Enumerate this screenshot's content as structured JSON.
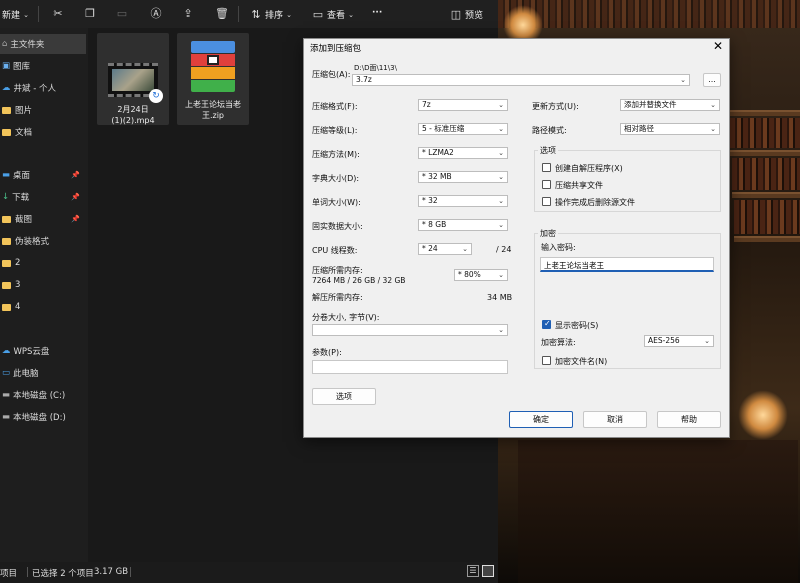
{
  "toolbar": {
    "new_label": "新建",
    "sort_label": "排序",
    "view_label": "查看",
    "more_label": "···",
    "preview_label": "预览"
  },
  "sidebar": {
    "items": [
      {
        "label": "主文件夹",
        "icon": "home-icon"
      },
      {
        "label": "图库",
        "icon": "gallery-icon"
      },
      {
        "label": "井斌 - 个人",
        "icon": "cloud-icon"
      },
      {
        "label": "图片",
        "icon": "folder-icon"
      },
      {
        "label": "文档",
        "icon": "folder-icon"
      },
      {
        "label": "桌面",
        "icon": "desktop-icon"
      },
      {
        "label": "下载",
        "icon": "download-icon"
      },
      {
        "label": "截图",
        "icon": "folder-icon"
      },
      {
        "label": "伪装格式",
        "icon": "folder-icon"
      },
      {
        "label": "2",
        "icon": "folder-icon"
      },
      {
        "label": "3",
        "icon": "folder-icon"
      },
      {
        "label": "4",
        "icon": "folder-icon"
      },
      {
        "label": "WPS云盘",
        "icon": "cloud-icon"
      },
      {
        "label": "此电脑",
        "icon": "computer-icon"
      },
      {
        "label": "本地磁盘 (C:)",
        "icon": "drive-icon"
      },
      {
        "label": "本地磁盘 (D:)",
        "icon": "drive-icon"
      }
    ]
  },
  "files": [
    {
      "name_line1": "2月24日",
      "name_line2": "(1)(2).mp4"
    },
    {
      "name_line1": "上老王论坛当老",
      "name_line2": "王.zip"
    }
  ],
  "status": {
    "items": "项目",
    "selected": "已选择 2 个项目",
    "size": "3.17 GB"
  },
  "dialog": {
    "title": "添加到压缩包",
    "archive_label": "压缩包(A):",
    "archive_path": "D:\\D面\\11\\3\\",
    "archive_name": "3.7z",
    "browse_label": "...",
    "format_label": "压缩格式(F):",
    "format_value": "7z",
    "level_label": "压缩等级(L):",
    "level_value": "5 - 标准压缩",
    "method_label": "压缩方法(M):",
    "method_value": "* LZMA2",
    "dict_label": "字典大小(D):",
    "dict_value": "* 32 MB",
    "word_label": "单词大小(W):",
    "word_value": "* 32",
    "solid_label": "固实数据大小:",
    "solid_value": "* 8 GB",
    "cpu_label": "CPU 线程数:",
    "cpu_value": "* 24",
    "cpu_total": "/ 24",
    "mem_comp_label": "压缩所需内存:",
    "mem_comp_detail": "7264 MB / 26 GB / 32 GB",
    "mem_comp_value": "* 80%",
    "mem_decomp_label": "解压所需内存:",
    "mem_decomp_value": "34 MB",
    "split_label": "分卷大小, 字节(V):",
    "params_label": "参数(P):",
    "options_button": "选项",
    "update_label": "更新方式(U):",
    "update_value": "添加并替换文件",
    "path_label": "路径模式:",
    "path_value": "相对路径",
    "options_group": "选项",
    "opt_sfx": "创建自解压程序(X)",
    "opt_shared": "压缩共享文件",
    "opt_delete": "操作完成后删除源文件",
    "encrypt_group": "加密",
    "password_label": "输入密码:",
    "password_value": "上老王论坛当老王",
    "show_password": "显示密码(S)",
    "enc_method_label": "加密算法:",
    "enc_method_value": "AES-256",
    "enc_filenames": "加密文件名(N)",
    "ok_button": "确定",
    "cancel_button": "取消",
    "help_button": "帮助",
    "close_glyph": "✕"
  }
}
